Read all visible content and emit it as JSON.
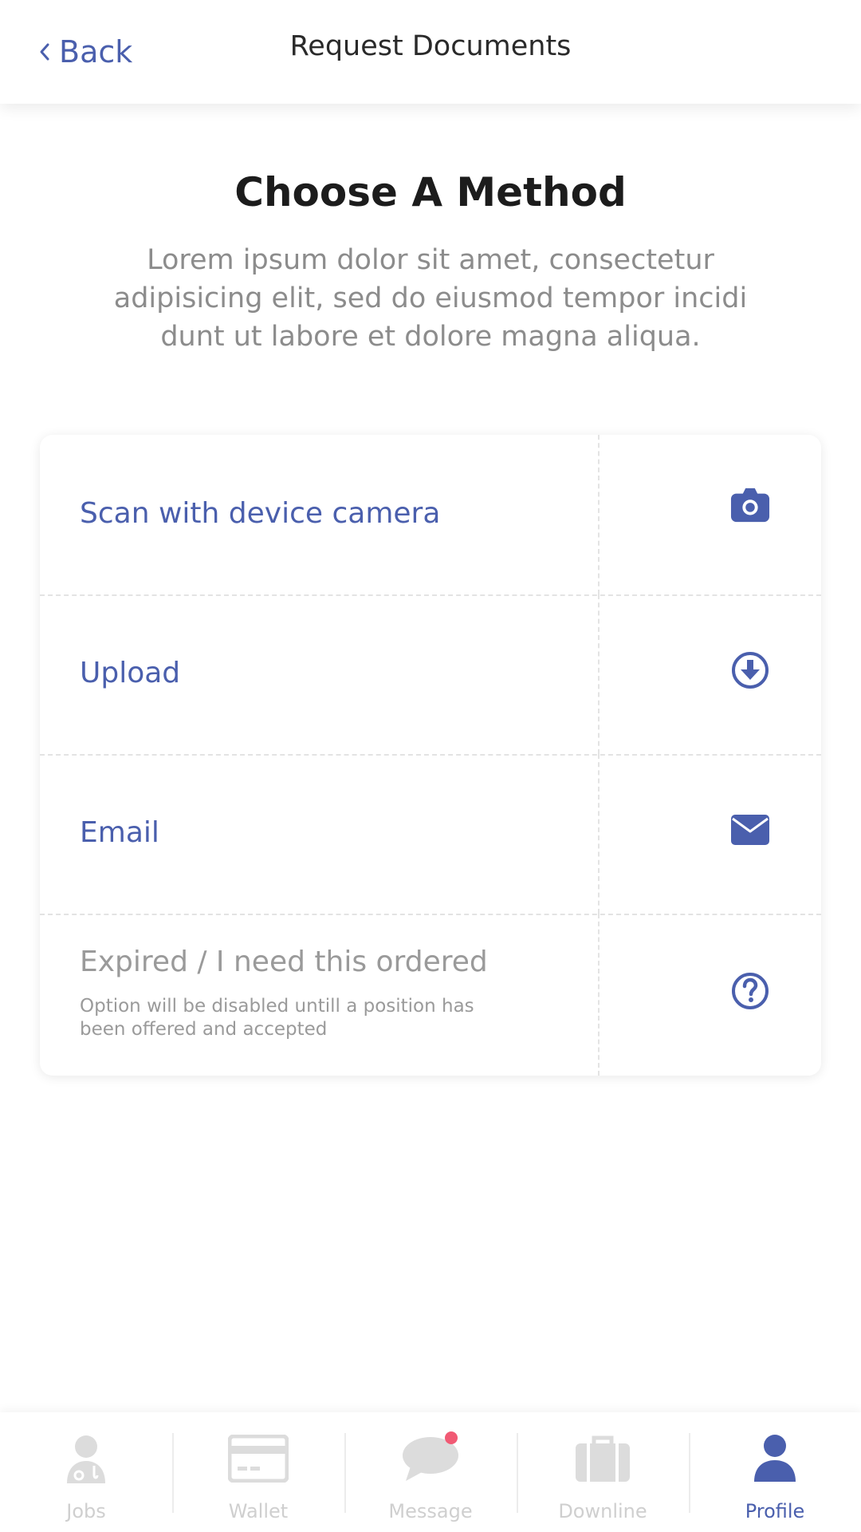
{
  "header": {
    "back_label": "Back",
    "title": "Request Documents"
  },
  "intro": {
    "heading": "Choose A Method",
    "description": "Lorem ipsum dolor sit amet, consectetur adipisicing elit, sed do eiusmod tempor incidi dunt ut labore et dolore magna aliqua."
  },
  "methods": [
    {
      "label": "Scan with device camera",
      "icon": "camera-icon",
      "enabled": true
    },
    {
      "label": "Upload",
      "icon": "download-circle-icon",
      "enabled": true
    },
    {
      "label": "Email",
      "icon": "envelope-icon",
      "enabled": true
    },
    {
      "label": "Expired / I need this ordered",
      "note": "Option will be disabled untill a position has been offered and accepted",
      "icon": "question-circle-icon",
      "enabled": false
    }
  ],
  "nav": {
    "items": [
      {
        "label": "Jobs",
        "icon": "doctor-icon",
        "active": false
      },
      {
        "label": "Wallet",
        "icon": "credit-card-icon",
        "active": false
      },
      {
        "label": "Message",
        "icon": "chat-bubble-icon",
        "active": false,
        "has_notification": true
      },
      {
        "label": "Downline",
        "icon": "briefcase-icon",
        "active": false
      },
      {
        "label": "Profile",
        "icon": "user-icon",
        "active": true
      }
    ]
  },
  "colors": {
    "accent": "#4a5fad",
    "muted_text": "#8c8c8c",
    "inactive_nav": "#cfcfcf",
    "notification": "#f15a74"
  }
}
